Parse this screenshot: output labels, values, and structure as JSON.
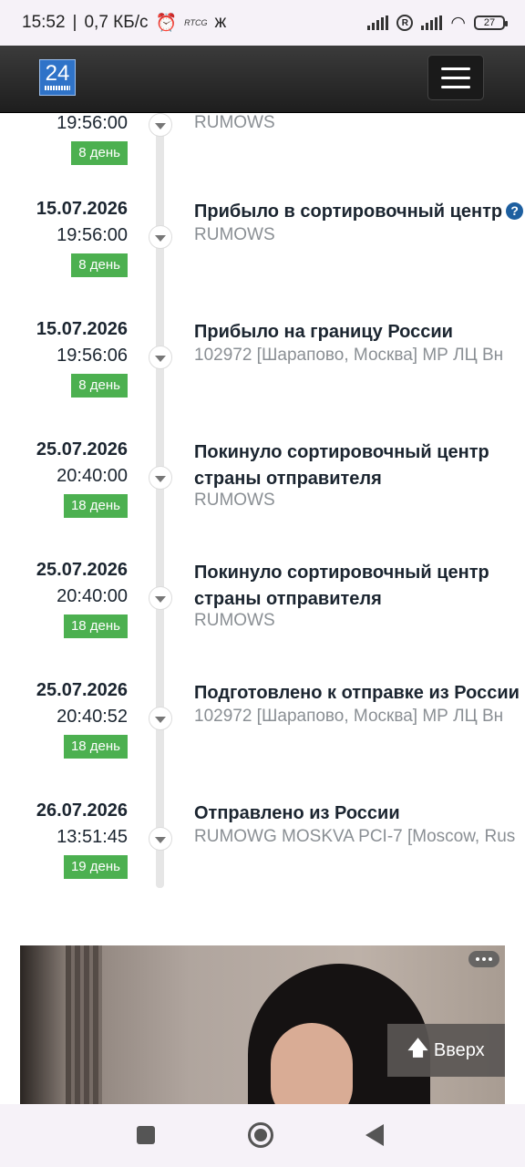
{
  "status_bar": {
    "time": "15:52",
    "speed": "0,7 КБ/с",
    "rtcg": "RTCG",
    "battery": "27"
  },
  "header": {
    "logo_text": "24"
  },
  "events": [
    {
      "date": "",
      "time": "19:56:00",
      "days": "8 день",
      "title": "",
      "location": "RUMOWS"
    },
    {
      "date": "15.07.2026",
      "time": "19:56:00",
      "days": "8 день",
      "title": "Прибыло в сортировочный центр",
      "location": "RUMOWS"
    },
    {
      "date": "15.07.2026",
      "time": "19:56:06",
      "days": "8 день",
      "title": "Прибыло на границу России",
      "location": "102972 [Шарапово, Москва] МР ЛЦ Вн"
    },
    {
      "date": "25.07.2026",
      "time": "20:40:00",
      "days": "18 день",
      "title": "Покинуло сортировочный центр страны отправителя",
      "location": "RUMOWS"
    },
    {
      "date": "25.07.2026",
      "time": "20:40:00",
      "days": "18 день",
      "title": "Покинуло сортировочный центр страны отправителя",
      "location": "RUMOWS"
    },
    {
      "date": "25.07.2026",
      "time": "20:40:52",
      "days": "18 день",
      "title": "Подготовлено к отправке из России",
      "location": "102972 [Шарапово, Москва] МР ЛЦ Вн"
    },
    {
      "date": "26.07.2026",
      "time": "13:51:45",
      "days": "19 день",
      "title": "Отправлено из России",
      "location": "RUMOWG MOSKVA PCI-7 [Moscow, Rus"
    }
  ],
  "help_mark": "?",
  "up_button": {
    "label": "Вверх",
    "icon": "arrow-up-icon"
  },
  "colors": {
    "badge": "#4cb050",
    "header": "#2b2b2b",
    "help": "#1d5fa0"
  }
}
